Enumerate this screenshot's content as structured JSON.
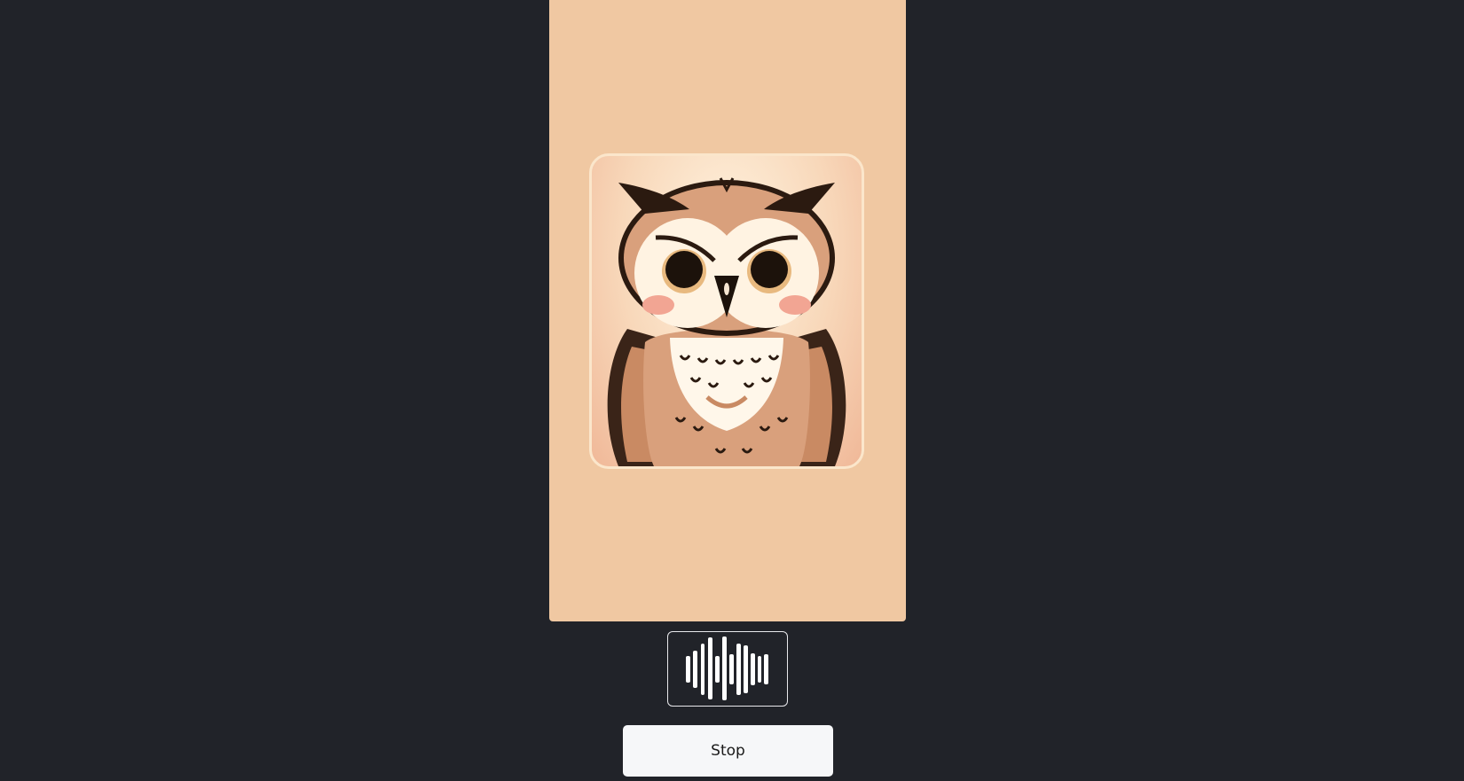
{
  "controls": {
    "stop_label": "Stop"
  },
  "icons": {
    "avatar": "owl-illustration",
    "audio": "audio-waveform-icon"
  },
  "colors": {
    "background": "#212329",
    "card": "#f0c8a2",
    "button": "#f6f7f9",
    "waveform": "#ffffff"
  }
}
